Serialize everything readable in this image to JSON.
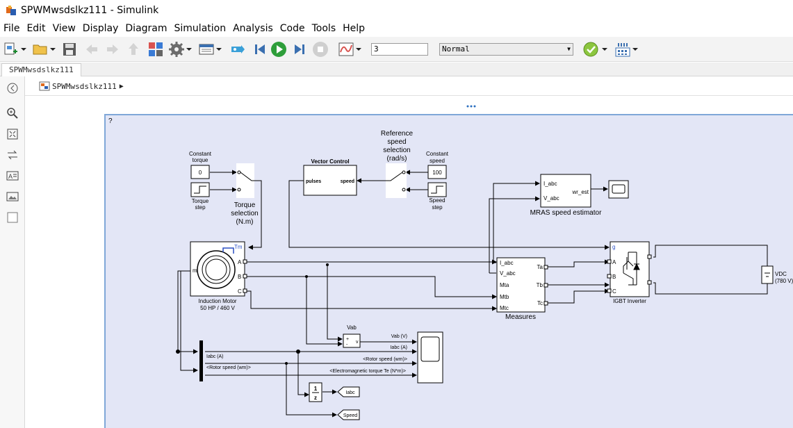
{
  "window": {
    "title": "SPWMwsdslkz111 - Simulink"
  },
  "menu": [
    "File",
    "Edit",
    "View",
    "Display",
    "Diagram",
    "Simulation",
    "Analysis",
    "Code",
    "Tools",
    "Help"
  ],
  "toolbar": {
    "stop_time": "3",
    "sim_mode": "Normal"
  },
  "tab": {
    "label": "SPWMwsdslkz111"
  },
  "breadcrumb": {
    "model": "SPWMwsdslkz111"
  },
  "model": {
    "corner_mark": "?",
    "constant_torque": {
      "label1": "Constant",
      "label2": "torque",
      "value": "0"
    },
    "torque_step": {
      "label1": "Torque",
      "label2": "step"
    },
    "torque_selection": {
      "line1": "Torque",
      "line2": "selection",
      "line3": "(N.m)"
    },
    "vector_control": {
      "title": "Vector Control",
      "in_port": "pulses",
      "out_port": "speed"
    },
    "reference_speed": {
      "line1": "Reference",
      "line2": "speed",
      "line3": "selection",
      "line4": "(rad/s)"
    },
    "constant_speed": {
      "label1": "Constant",
      "label2": "speed",
      "value": "100"
    },
    "speed_step": {
      "label1": "Speed",
      "label2": "step"
    },
    "mras": {
      "port_i": "I_abc",
      "port_v": "V_abc",
      "port_out": "wr_est",
      "label": "MRAS speed estimator"
    },
    "motor": {
      "port_tm": "Tm",
      "port_m": "m",
      "port_a": "A",
      "port_b": "B",
      "port_c": "C",
      "label1": "Induction Motor",
      "label2": "50 HP / 460 V"
    },
    "measures": {
      "in1": "I_abc",
      "in2": "V_abc",
      "in3": "Mta",
      "in4": "Mtb",
      "in5": "Mtc",
      "out1": "Ta",
      "out2": "Tb",
      "out3": "Tc",
      "label": "Measures"
    },
    "inverter": {
      "port_g": "g",
      "port_a": "A",
      "port_b": "B",
      "port_c": "C",
      "label": "IGBT Inverter"
    },
    "vdc": {
      "label1": "VDC",
      "label2": "(780 V)"
    },
    "vab": {
      "label": "Vab",
      "plus": "+",
      "minus": "-",
      "out": "v"
    },
    "signals": {
      "vab_v": "Vab (V)",
      "iabc_a_right": "Iabc (A)",
      "iabc_a_left": "Iabc (A)",
      "rotor_speed_left": "<Rotor speed (wm)>",
      "rotor_speed_right": "<Rotor speed (wm)>",
      "em_torque": "<Electromagnetic torque Te (N*m)>"
    },
    "unit_delay": {
      "num": "1",
      "den": "z"
    },
    "goto_iabc": "Iabc",
    "goto_speed": "Speed"
  }
}
